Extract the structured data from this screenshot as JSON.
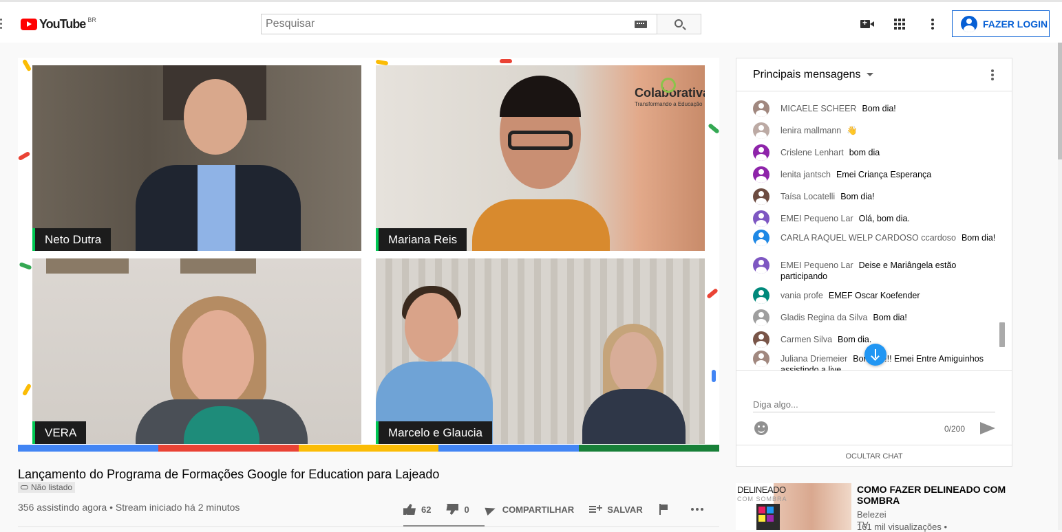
{
  "header": {
    "logo_text": "YouTube",
    "logo_country": "BR",
    "search_placeholder": "Pesquisar",
    "login_label": "FAZER LOGIN"
  },
  "player": {
    "tiles": [
      {
        "name": "Neto Dutra"
      },
      {
        "name": "Mariana Reis"
      },
      {
        "name": "VERA"
      },
      {
        "name": "Marcelo e Glaucia"
      }
    ],
    "watermark_title": "Colaborativa",
    "watermark_subtitle": "Transformando a Educação",
    "brand_colors": [
      "#4285f4",
      "#ea4335",
      "#fbbc05",
      "#4285f4",
      "#34a853"
    ]
  },
  "video": {
    "title": "Lançamento do Programa de Formações Google for Education para Lajeado",
    "badge": "Não listado",
    "stats": "356 assistindo agora • Stream iniciado há 2 minutos",
    "likes": "62",
    "dislikes": "0",
    "share_label": "COMPARTILHAR",
    "save_label": "SALVAR"
  },
  "chat": {
    "header": "Principais mensagens",
    "messages": [
      {
        "author": "MICAELE SCHEER",
        "text": "Bom dia!",
        "avatar": "#a1887f"
      },
      {
        "author": "lenira mallmann",
        "text": "👋",
        "avatar": "#bcaaa4"
      },
      {
        "author": "Crislene Lenhart",
        "text": "bom dia",
        "avatar": "#8e24aa"
      },
      {
        "author": "lenita jantsch",
        "text": "Emei Criança Esperança",
        "avatar": "#8e24aa"
      },
      {
        "author": "Taísa Locatelli",
        "text": "Bom dia!",
        "avatar": "#6d4c41"
      },
      {
        "author": "EMEI Pequeno Lar",
        "text": "Olá, bom dia.",
        "avatar": "#7e57c2"
      },
      {
        "author": "CARLA RAQUEL WELP CARDOSO ccardoso",
        "text": "Bom dia!",
        "avatar": "#1e88e5"
      },
      {
        "author": "EMEI Pequeno Lar",
        "text": "Deise e Mariângela estão participando",
        "avatar": "#7e57c2"
      },
      {
        "author": "vania profe",
        "text": "EMEF Oscar Koefender",
        "avatar": "#00897b"
      },
      {
        "author": "Gladis Regina da Silva",
        "text": "Bom dia!",
        "avatar": "#9e9e9e"
      },
      {
        "author": "Carmen Silva",
        "text": "Bom dia.",
        "avatar": "#795548"
      },
      {
        "author": "Juliana Driemeier",
        "text": "Bom dia!!! Emei Entre Amiguinhos assistindo a live ...",
        "avatar": "#a1887f"
      }
    ],
    "input_placeholder": "Diga algo...",
    "char_count": "0/200",
    "hide_label": "OCULTAR CHAT"
  },
  "recommendation": {
    "thumb_text_1": "DELINEADO",
    "thumb_text_2": "COM SOMBRA",
    "title": "COMO FAZER DELINEADO COM SOMBRA",
    "channel": "Belezei TV",
    "views": "161 mil visualizações •"
  }
}
